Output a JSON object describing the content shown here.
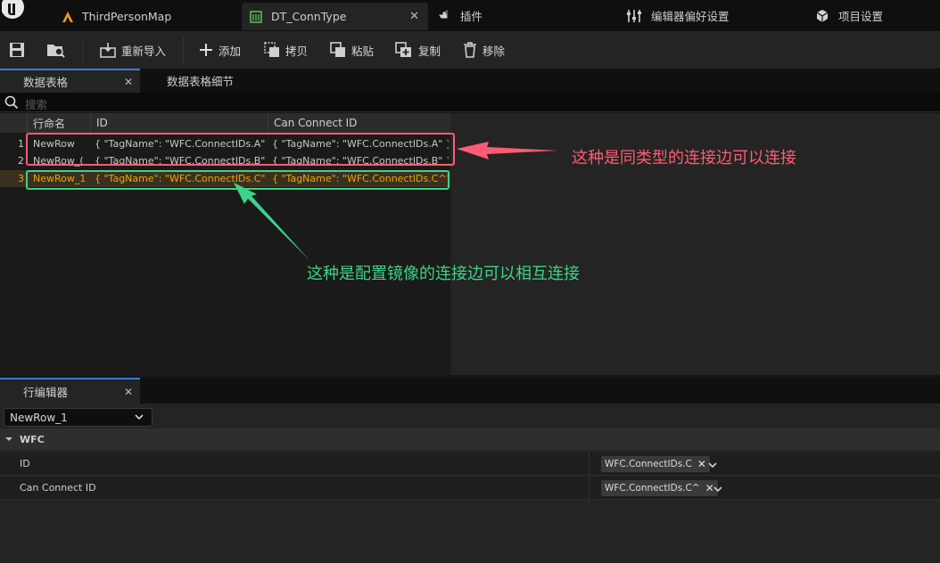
{
  "titlebar": {
    "tabs": [
      {
        "label": "ThirdPersonMap"
      },
      {
        "label": "DT_ConnType"
      }
    ],
    "items": [
      {
        "label": "插件"
      },
      {
        "label": "编辑器偏好设置"
      },
      {
        "label": "项目设置"
      }
    ]
  },
  "toolbar": {
    "reimport": "重新导入",
    "add": "添加",
    "copy": "拷贝",
    "paste": "粘贴",
    "duplicate": "复制",
    "remove": "移除"
  },
  "panel_tabs": {
    "data_table": "数据表格",
    "details": "数据表格细节"
  },
  "search": {
    "placeholder": "搜索"
  },
  "table": {
    "headers": {
      "row_name": "行命名",
      "id": "ID",
      "can_connect": "Can Connect ID"
    },
    "rows": [
      {
        "index": "1",
        "name": "NewRow",
        "id": "{ \"TagName\": \"WFC.ConnectIDs.A\" }",
        "can_connect": "{ \"TagName\": \"WFC.ConnectIDs.A\" }"
      },
      {
        "index": "2",
        "name": "NewRow_(",
        "id": "{ \"TagName\": \"WFC.ConnectIDs.B\" }",
        "can_connect": "{ \"TagName\": \"WFC.ConnectIDs.B\" }"
      },
      {
        "index": "3",
        "name": "NewRow_1",
        "id": "{ \"TagName\": \"WFC.ConnectIDs.C\" }",
        "can_connect": "{ \"TagName\": \"WFC.ConnectIDs.C^\" }"
      }
    ],
    "selected_index": "3"
  },
  "row_editor": {
    "tab_label": "行编辑器",
    "selected_row": "NewRow_1",
    "category": "WFC",
    "props": [
      {
        "name": "ID",
        "value": "WFC.ConnectIDs.C"
      },
      {
        "name": "Can Connect ID",
        "value": "WFC.ConnectIDs.C^"
      }
    ]
  },
  "annotations": {
    "red_text": "这种是同类型的连接边可以连接",
    "green_text": "这种是配置镜像的连接边可以相互连接",
    "red_color": "#ff5b73",
    "green_color": "#3ed28a"
  },
  "colors": {
    "selected_row_text": "#f0a500",
    "accent": "#3a7bd5"
  }
}
